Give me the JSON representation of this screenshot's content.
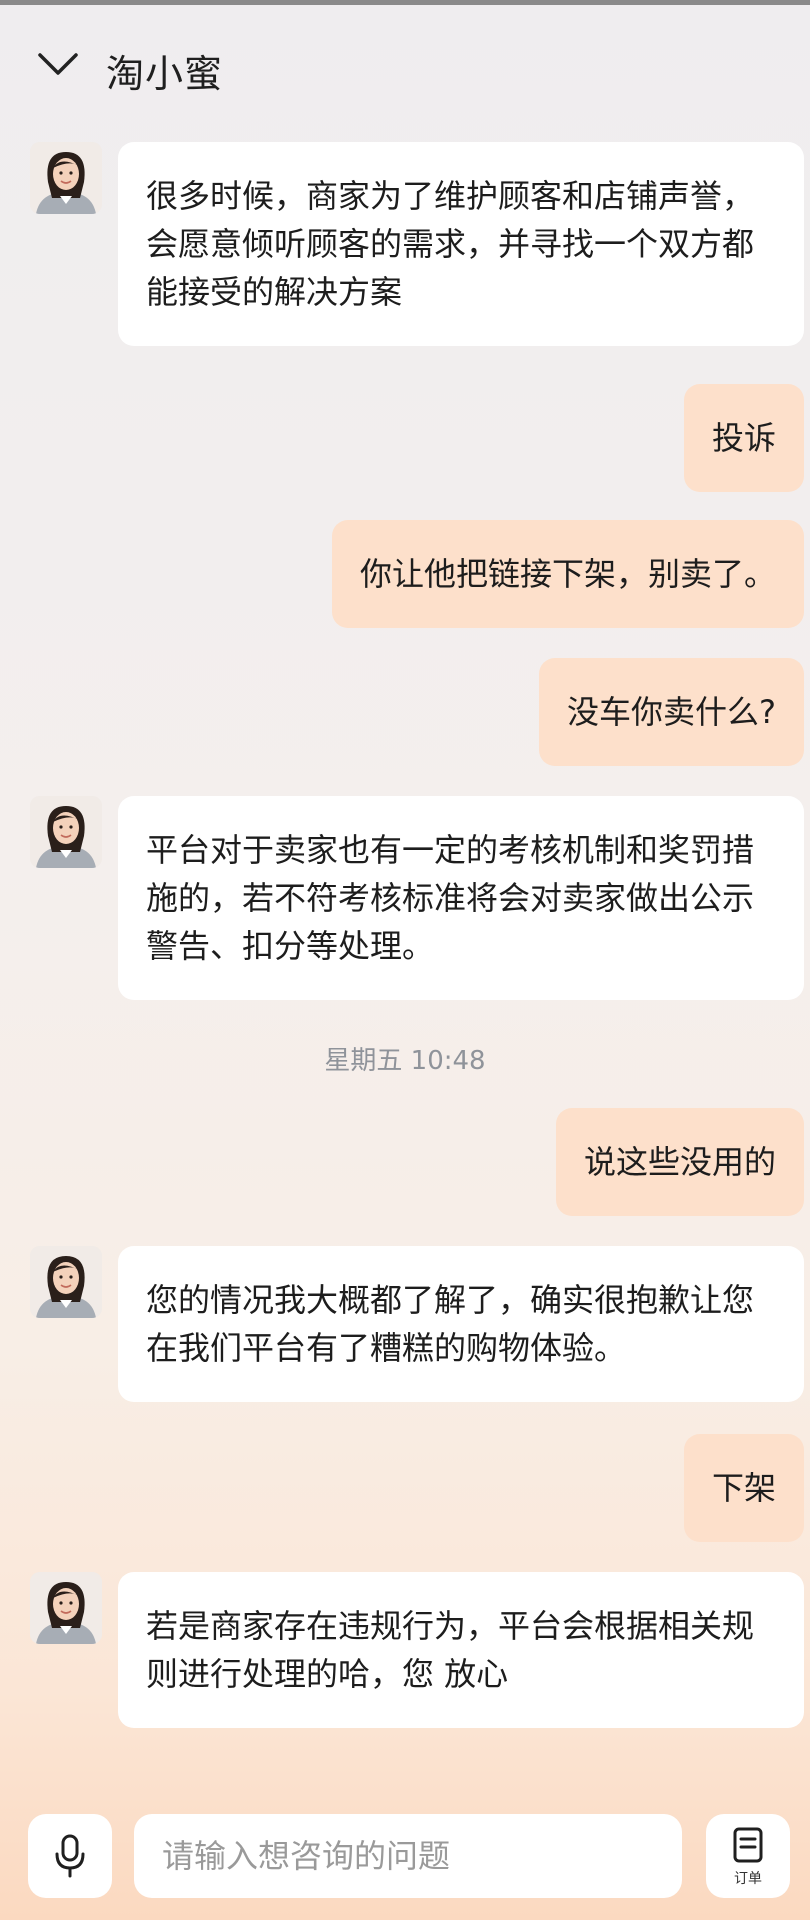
{
  "header": {
    "title": "淘小蜜"
  },
  "messages": [
    {
      "from": "bot",
      "text": "很多时候，商家为了维护顾客和店铺声誉，会愿意倾听顾客的需求，并寻找一个双方都能接受的解决方案"
    },
    {
      "from": "user",
      "text": "投诉"
    },
    {
      "from": "user",
      "text": "你让他把链接下架，别卖了。"
    },
    {
      "from": "user",
      "text": "没车你卖什么?"
    },
    {
      "from": "bot",
      "text": "平台对于卖家也有一定的考核机制和奖罚措施的，若不符考核标准将会对卖家做出公示警告、扣分等处理。"
    },
    {
      "from": "system",
      "text": "星期五 10:48"
    },
    {
      "from": "user",
      "text": "说这些没用的"
    },
    {
      "from": "bot",
      "text": "您的情况我大概都了解了，确实很抱歉让您在我们平台有了糟糕的购物体验。"
    },
    {
      "from": "user",
      "text": "下架"
    },
    {
      "from": "bot",
      "text": "若是商家存在违规行为，平台会根据相关规则进行处理的哈，您 放心"
    }
  ],
  "input": {
    "placeholder": "请输入想咨询的问题"
  },
  "order_button": {
    "label": "订单"
  },
  "colors": {
    "user_bubble": "#fde0cb",
    "bot_bubble": "#ffffff"
  }
}
